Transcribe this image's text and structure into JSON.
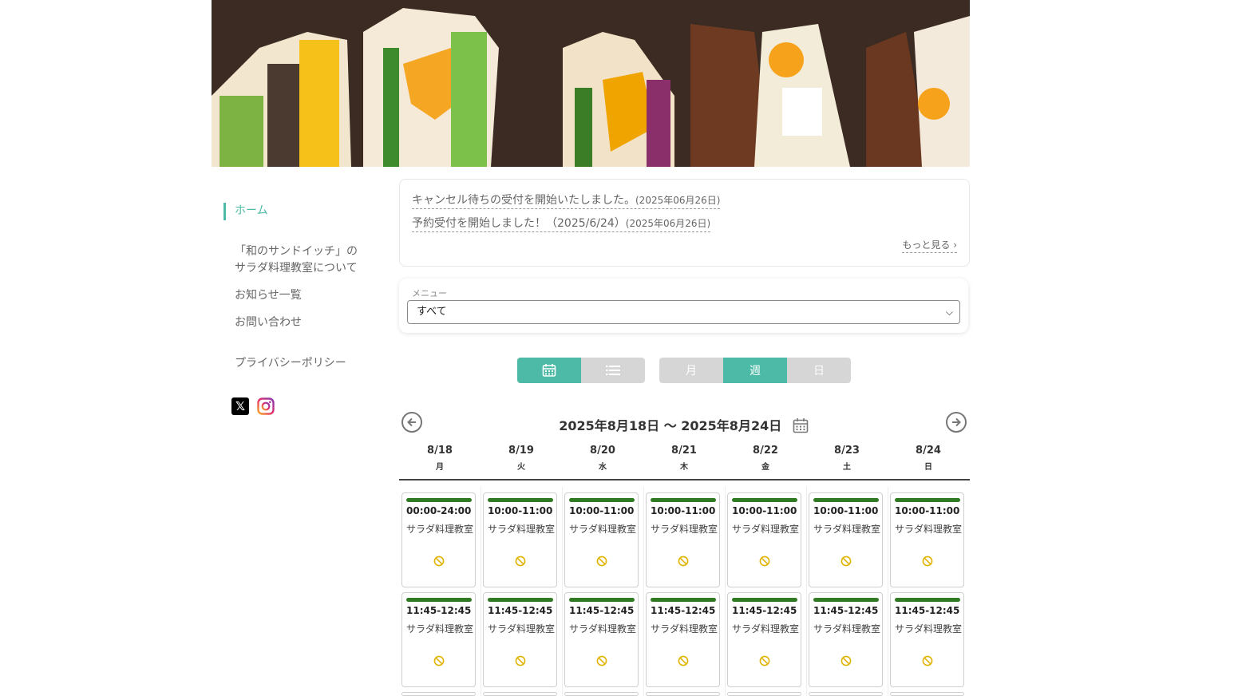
{
  "sidebar": {
    "items": [
      {
        "label": "ホーム",
        "active": true
      },
      {
        "label": "「和のサンドイッチ」の"
      },
      {
        "label": "サラダ料理教室について"
      },
      {
        "label": "お知らせ一覧"
      },
      {
        "label": "お問い合わせ"
      },
      {
        "label": "プライバシーポリシー"
      }
    ],
    "social": {
      "x_label": "𝕏"
    }
  },
  "news": {
    "items": [
      {
        "text": "キャンセル待ちの受付を開始いたしました。",
        "date": "(2025年06月26日)"
      },
      {
        "text": "予約受付を開始しました！（2025/6/24）",
        "date": "(2025年06月26日)"
      }
    ],
    "more": "もっと見る"
  },
  "menu": {
    "label": "メニュー",
    "selected": "すべて"
  },
  "view_toggle": {
    "calendar_icon": "calendar-icon",
    "list_icon": "list-icon"
  },
  "range_toggle": {
    "month": "月",
    "week": "週",
    "day": "日",
    "active": "week"
  },
  "week": {
    "title": "2025年8月18日 〜 2025年8月24日"
  },
  "days": [
    {
      "date": "8/18",
      "weekday": "月"
    },
    {
      "date": "8/19",
      "weekday": "火"
    },
    {
      "date": "8/20",
      "weekday": "水"
    },
    {
      "date": "8/21",
      "weekday": "木"
    },
    {
      "date": "8/22",
      "weekday": "金"
    },
    {
      "date": "8/23",
      "weekday": "土"
    },
    {
      "date": "8/24",
      "weekday": "日"
    }
  ],
  "slots": {
    "row1": [
      "00:00-24:00",
      "10:00-11:00",
      "10:00-11:00",
      "10:00-11:00",
      "10:00-11:00",
      "10:00-11:00",
      "10:00-11:00"
    ],
    "row2": [
      "11:45-12:45",
      "11:45-12:45",
      "11:45-12:45",
      "11:45-12:45",
      "11:45-12:45",
      "11:45-12:45",
      "11:45-12:45"
    ],
    "title": "サラダ料理教室",
    "status_icon": "unavailable-icon"
  },
  "colors": {
    "accent": "#4cbaa6",
    "slot_bar": "#2f7a22",
    "status": "#e0b400"
  }
}
